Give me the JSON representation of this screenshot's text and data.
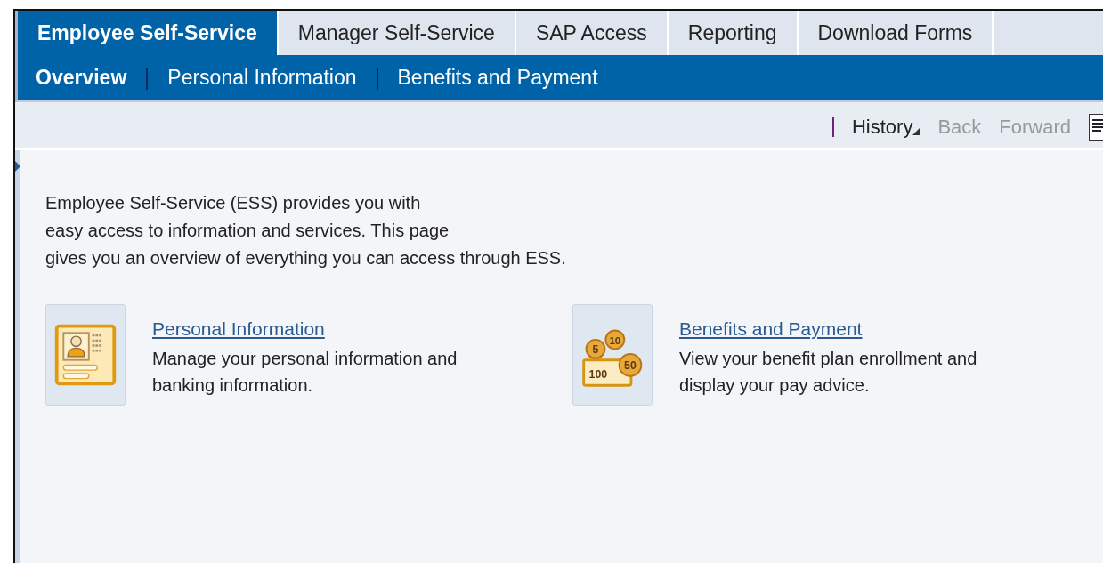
{
  "tabs": [
    {
      "label": "Employee Self-Service",
      "selected": true
    },
    {
      "label": "Manager Self-Service",
      "selected": false
    },
    {
      "label": "SAP Access",
      "selected": false
    },
    {
      "label": "Reporting",
      "selected": false
    },
    {
      "label": "Download Forms",
      "selected": false
    }
  ],
  "subnav": [
    {
      "label": "Overview",
      "selected": true
    },
    {
      "label": "Personal Information",
      "selected": false
    },
    {
      "label": "Benefits and Payment",
      "selected": false
    }
  ],
  "toolbar": [
    {
      "label": "History",
      "disabled": false,
      "menu": true
    },
    {
      "label": "Back",
      "disabled": true,
      "menu": false
    },
    {
      "label": "Forward",
      "disabled": true,
      "menu": false
    }
  ],
  "intro": "Employee Self-Service (ESS) provides you with\neasy access to information and services. This page\ngives you an overview of everything you can access through ESS.",
  "services": [
    {
      "kind": "person",
      "title": "Personal Information",
      "description": "Manage your personal information and\nbanking information."
    },
    {
      "kind": "money",
      "title": "Benefits and Payment",
      "description": "View your benefit plan enrollment and\ndisplay your pay advice.",
      "icon_labels": [
        "5",
        "10",
        "100",
        "50"
      ]
    }
  ]
}
